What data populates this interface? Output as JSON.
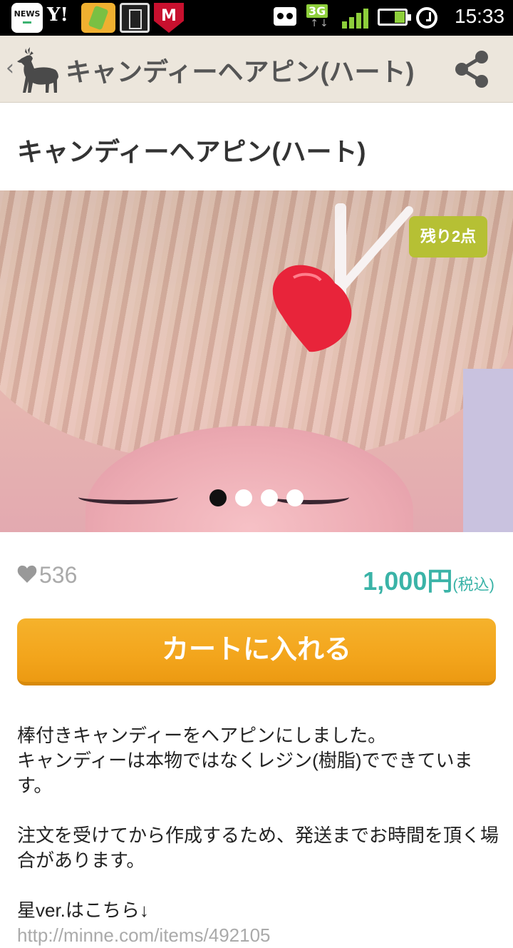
{
  "status_bar": {
    "news_label": "NEWS",
    "yahoo_label": "Y!",
    "mcafee_label": "M",
    "network_type": "3G",
    "network_arrows": "↑↓",
    "time": "15:33"
  },
  "app_bar": {
    "back_glyph": "‹",
    "title": "キャンディーヘアピン(ハート)",
    "share_icon": "share-icon"
  },
  "product": {
    "title": "キャンディーヘアピン(ハート)",
    "stock_badge": "残り2点",
    "image_page_count": 4,
    "image_active_index": 0,
    "likes": "536",
    "price": "1,000円",
    "tax_note": "(税込)",
    "cart_button": "カートに入れる"
  },
  "description": {
    "line1": "棒付きキャンディーをヘアピンにしました。",
    "line2": "キャンディーは本物ではなくレジン(樹脂)でできています。",
    "line3": "注文を受けてから作成するため、発送までお時間を頂く場合があります。",
    "line4": "星ver.はこちら↓",
    "line5": "http://minne.com/items/492105"
  },
  "colors": {
    "accent_teal": "#3ab3a7",
    "cart_orange": "#f3a51c",
    "badge_green": "#b6c034",
    "appbar_bg": "#ece6dc"
  }
}
